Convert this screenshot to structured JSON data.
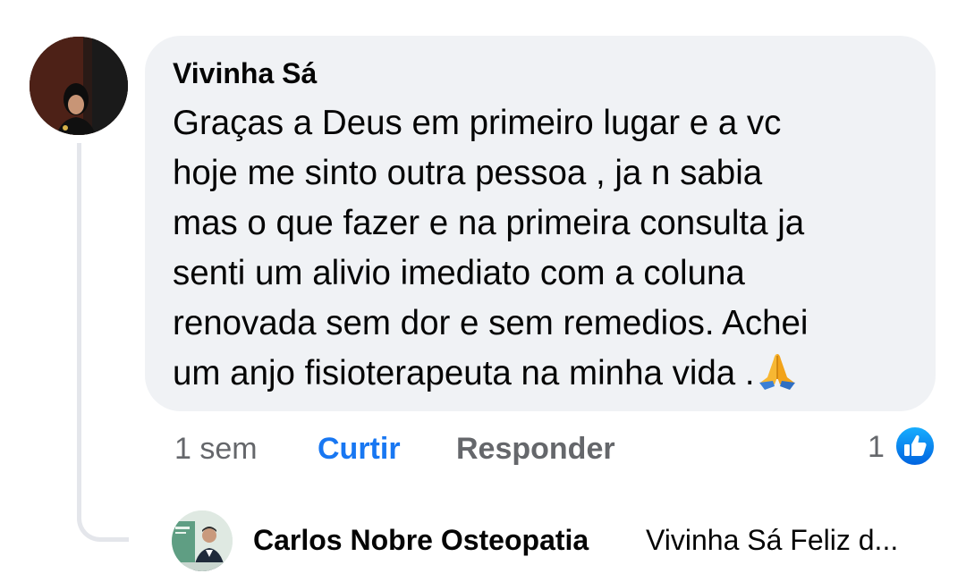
{
  "comment": {
    "author": "Vivinha Sá",
    "lines": [
      "Graças a Deus em primeiro lugar e a vc",
      "hoje me sinto outra pessoa , ja n sabia",
      "mas o que fazer e na primeira consulta ja",
      "senti um alivio imediato com a coluna",
      "renovada sem dor e sem remedios. Achei",
      "um anjo fisioterapeuta na minha vida ."
    ],
    "emoji": "folded-hands-icon",
    "time": "1 sem",
    "like_label": "Curtir",
    "reply_label": "Responder",
    "reaction_count": "1",
    "reaction_icon": "like-thumb-icon"
  },
  "reply": {
    "author": "Carlos Nobre Osteopatia",
    "preview": "Vivinha Sá Feliz d..."
  },
  "colors": {
    "bubble": "#f0f2f5",
    "accent": "#1877f2",
    "muted": "#65676b",
    "thread_line": "#e4e6eb"
  }
}
